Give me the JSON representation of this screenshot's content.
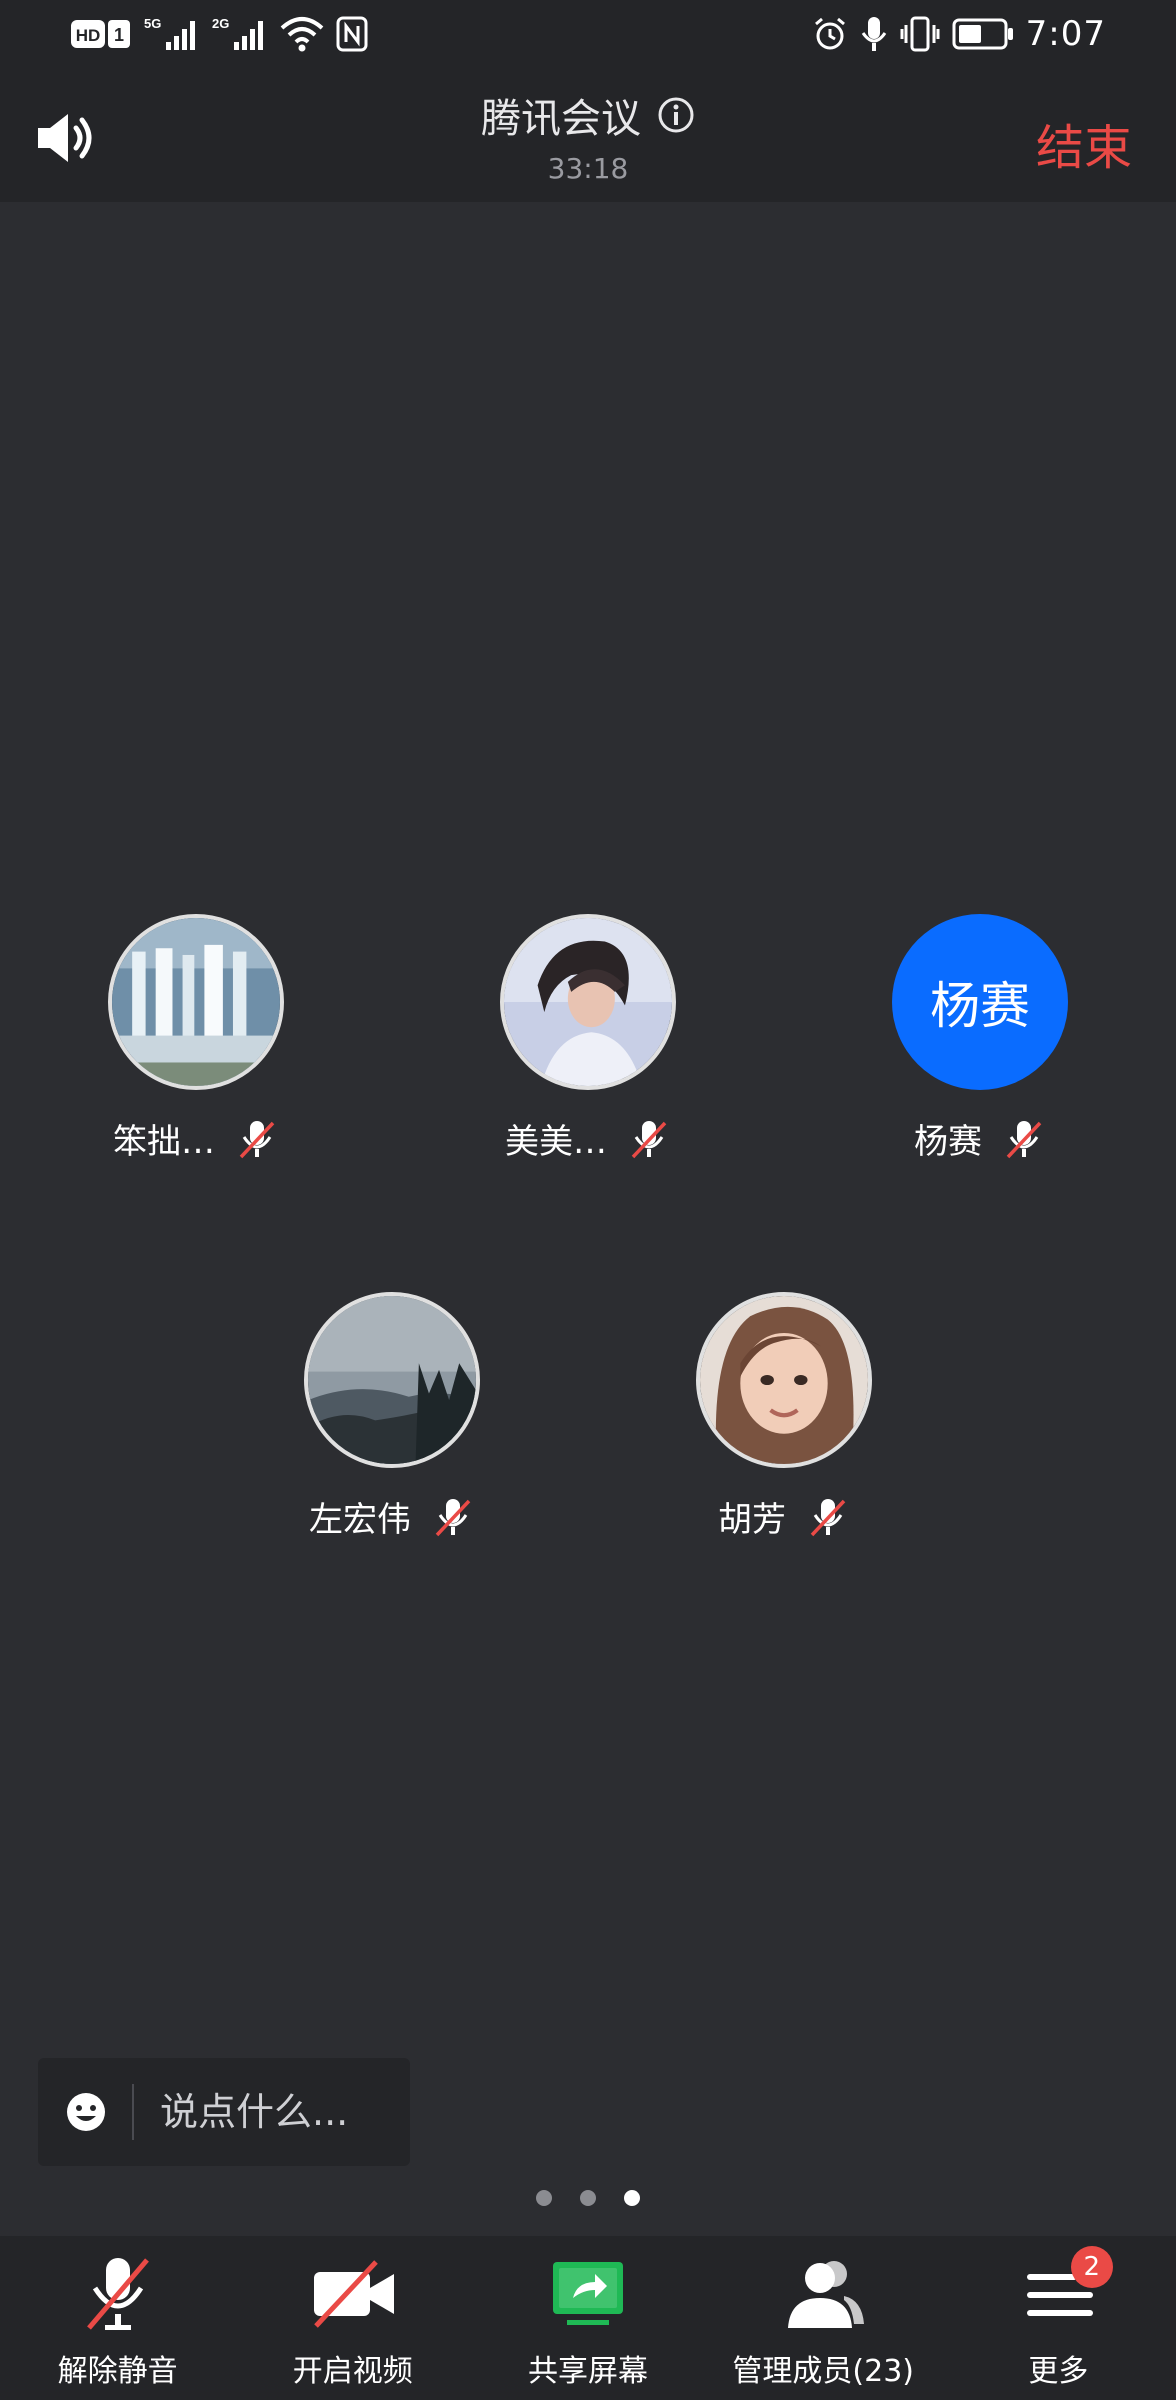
{
  "status_bar": {
    "time": "7:07",
    "hd": "HD",
    "sim": "1",
    "net1": "5G",
    "net2": "2G",
    "icons": [
      "hd-icon",
      "signal-5g-icon",
      "signal-2g-icon",
      "wifi-icon",
      "nfc-icon",
      "alarm-icon",
      "mic-icon",
      "vibrate-icon",
      "battery-icon"
    ]
  },
  "header": {
    "title": "腾讯会议",
    "elapsed": "33:18",
    "end_label": "结束"
  },
  "participants": [
    {
      "name": "笨拙…",
      "avatar": "waterfall-photo",
      "muted": true
    },
    {
      "name": "美美…",
      "avatar": "girl-photo",
      "muted": true
    },
    {
      "name": "杨赛",
      "initials": "杨赛",
      "avatar_color": "#0a6cff",
      "muted": true
    },
    {
      "name": "左宏伟",
      "avatar": "mountain-photo",
      "muted": true
    },
    {
      "name": "胡芳",
      "avatar": "portrait-photo",
      "muted": true
    }
  ],
  "chat": {
    "placeholder": "说点什么..."
  },
  "pagination": {
    "total": 3,
    "current": 3
  },
  "toolbar": {
    "items": [
      {
        "label": "解除静音",
        "icon": "mic-muted-icon"
      },
      {
        "label": "开启视频",
        "icon": "video-off-icon"
      },
      {
        "label": "共享屏幕",
        "icon": "share-screen-icon"
      },
      {
        "label": "管理成员(23)",
        "icon": "members-icon"
      },
      {
        "label": "更多",
        "icon": "menu-icon",
        "badge": "2"
      }
    ]
  },
  "colors": {
    "background": "#2c2d31",
    "bar": "#242528",
    "end": "#ea4a46",
    "accent_blue": "#0a6cff",
    "share_green": "#1fb955"
  }
}
